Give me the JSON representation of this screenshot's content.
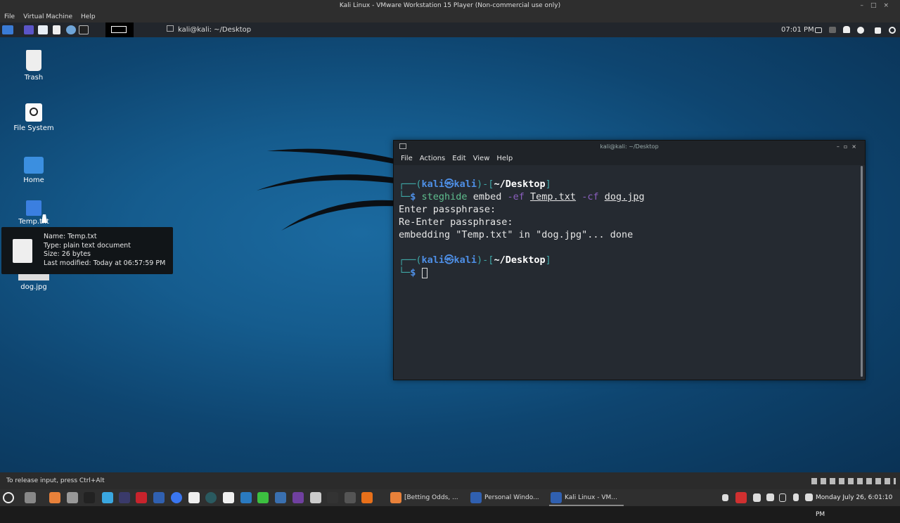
{
  "vm": {
    "title": "Kali Linux - VMware Workstation 15 Player (Non-commercial use only)",
    "menu": [
      "File",
      "Virtual Machine",
      "Help"
    ]
  },
  "panel": {
    "window_title": "kali@kali: ~/Desktop",
    "time": "07:01 PM"
  },
  "desktop": {
    "icons": [
      {
        "label": "Trash"
      },
      {
        "label": "File System"
      },
      {
        "label": "Home"
      },
      {
        "label": "Temp.txt"
      },
      {
        "label": "dog.jpg"
      }
    ]
  },
  "tooltip": {
    "name": "Name: Temp.txt",
    "type": "Type: plain text document",
    "size": "Size: 26 bytes",
    "modified": "Last modified: Today at 06:57:59 PM"
  },
  "terminal": {
    "title": "kali@kali: ~/Desktop",
    "menu": [
      "File",
      "Actions",
      "Edit",
      "View",
      "Help"
    ],
    "user": "kali",
    "host": "kali",
    "cwd": "~/Desktop",
    "cmd": "steghide",
    "arg1": "embed",
    "flag1": "-ef",
    "file1": "Temp.txt",
    "flag2": "-cf",
    "file2": "dog.jpg",
    "out1": "Enter passphrase:",
    "out2": "Re-Enter passphrase:",
    "out3": "embedding \"Temp.txt\" in \"dog.jpg\"... done"
  },
  "statusbar": {
    "text": "To release input, press Ctrl+Alt"
  },
  "taskbar": {
    "tasks": [
      "[Betting Odds, ...",
      "Personal Windo...",
      "Kali Linux - VM..."
    ],
    "clock": "Monday July 26, 6:01:10 PM"
  }
}
